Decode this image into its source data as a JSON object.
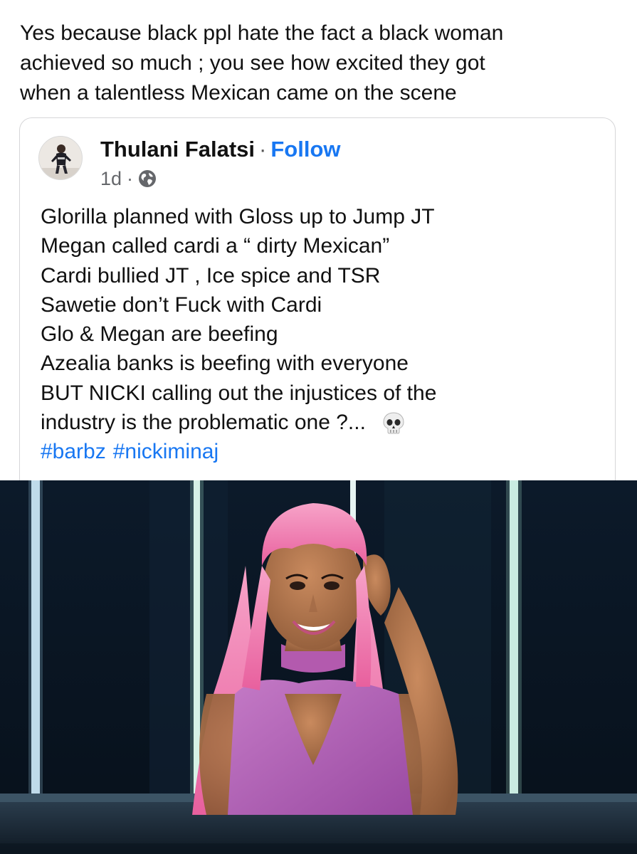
{
  "caption": {
    "text": "Yes because black ppl hate the fact a black woman\nachieved so much ; you see how excited they got\nwhen a talentless Mexican came on the scene"
  },
  "shared_post": {
    "author_name": "Thulani Falatsi",
    "separator": "·",
    "follow_label": "Follow",
    "timestamp": "1d",
    "meta_separator": "·",
    "audience_icon": "globe-icon",
    "lines": [
      "Glorilla planned with Gloss up to Jump JT",
      "Megan called cardi a “ dirty Mexican”",
      "Cardi bullied JT , Ice spice and TSR",
      "Sawetie don’t Fuck with Cardi",
      "Glo & Megan are beefing",
      "Azealia banks is beefing with everyone",
      "BUT NICKI calling out the injustices of the",
      "industry is the problematic one ?..."
    ],
    "trailing_emoji": "skull-emoji",
    "hashtags": [
      "#barbz",
      "#nickiminaj"
    ]
  },
  "photo": {
    "subject": "performer-photo"
  },
  "colors": {
    "link": "#1877f2",
    "meta": "#65676b",
    "card_border": "#d6d6d8",
    "stage_bg": "#0b1522",
    "hair_pink": "#f07cb0",
    "outfit_purple": "#b55fb8"
  }
}
